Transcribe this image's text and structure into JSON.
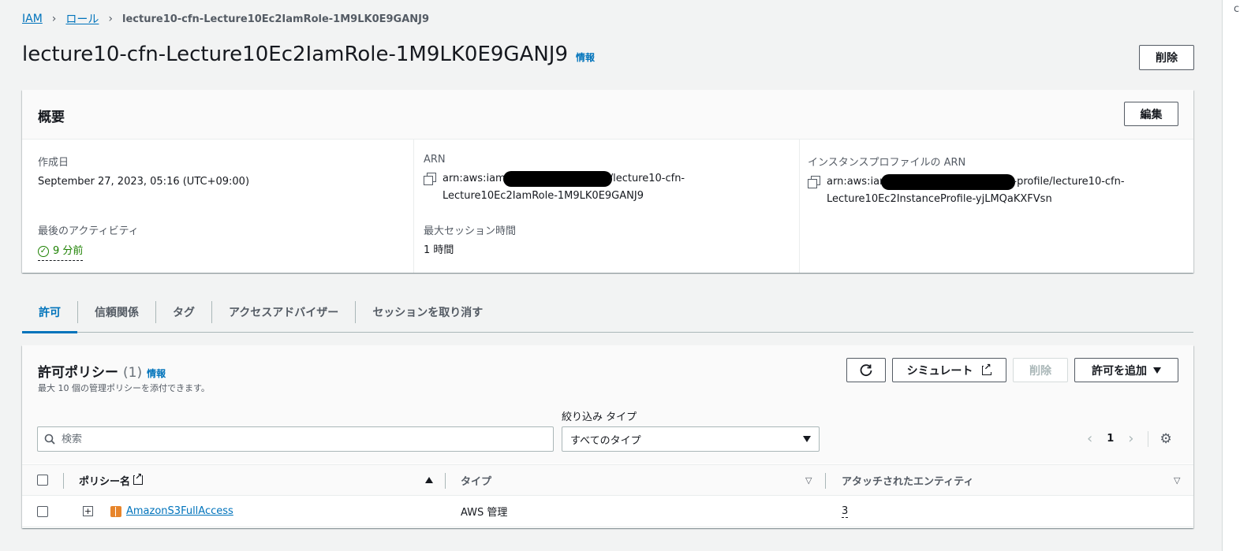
{
  "breadcrumb": {
    "items": [
      "IAM",
      "ロール"
    ],
    "current": "lecture10-cfn-Lecture10Ec2IamRole-1M9LK0E9GANJ9"
  },
  "page": {
    "title": "lecture10-cfn-Lecture10Ec2IamRole-1M9LK0E9GANJ9",
    "info": "情報",
    "delete_label": "削除"
  },
  "summary": {
    "title": "概要",
    "edit_label": "編集",
    "created_label": "作成日",
    "created_value": "September 27, 2023, 05:16 (UTC+09:00)",
    "arn_label": "ARN",
    "arn_prefix": "arn:aws:iam",
    "arn_suffix": "/lecture10-cfn-",
    "arn_line2": "Lecture10Ec2IamRole-1M9LK0E9GANJ9",
    "instance_arn_label": "インスタンスプロファイルの ARN",
    "instance_arn_prefix": "arn:aws:iar",
    "instance_arn_suffix": "-profile/lecture10-cfn-",
    "instance_arn_line2": "Lecture10Ec2InstanceProfile-yjLMQaKXFVsn",
    "activity_label": "最後のアクティビティ",
    "activity_value": "9 分前",
    "max_session_label": "最大セッション時間",
    "max_session_value": "1 時間"
  },
  "tabs": [
    "許可",
    "信頼関係",
    "タグ",
    "アクセスアドバイザー",
    "セッションを取り消す"
  ],
  "policies": {
    "title": "許可ポリシー",
    "count": "(1)",
    "info": "情報",
    "description": "最大 10 個の管理ポリシーを添付できます。",
    "simulate_label": "シミュレート",
    "delete_label": "削除",
    "add_label": "許可を追加",
    "search_placeholder": "検索",
    "filter_label": "絞り込み タイプ",
    "filter_value": "すべてのタイプ",
    "page": "1",
    "columns": [
      "ポリシー名",
      "タイプ",
      "アタッチされたエンティティ"
    ],
    "rows": [
      {
        "name": "AmazonS3FullAccess",
        "type": "AWS 管理",
        "entities": "3"
      }
    ]
  },
  "colors": {
    "link": "#0073bb",
    "success": "#1d8102",
    "background": "#f2f3f3",
    "s3_orange": "#e7852b"
  },
  "icons": [
    "chevron-right-icon",
    "copy-icon",
    "check-circle-icon",
    "refresh-icon",
    "external-link-icon",
    "caret-down-icon",
    "search-icon",
    "gear-icon",
    "expand-icon",
    "aws-s3-icon"
  ]
}
